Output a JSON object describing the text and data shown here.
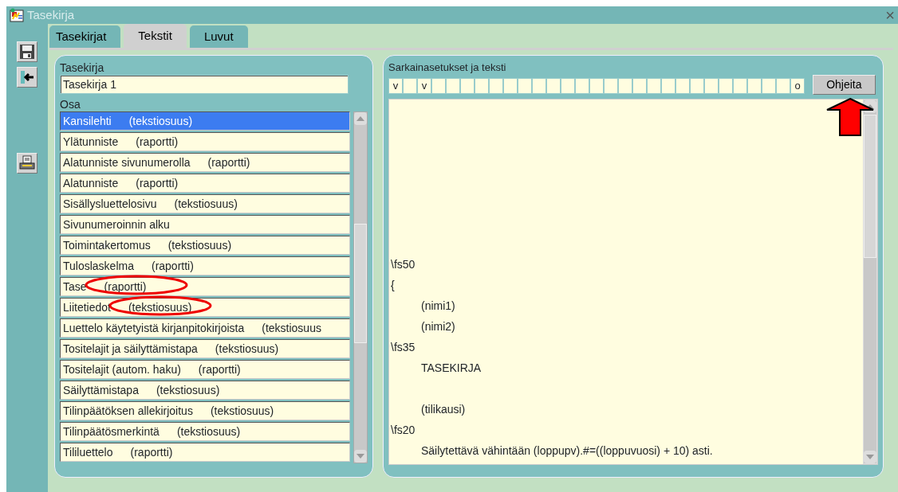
{
  "window": {
    "title": "Tasekirja",
    "close": "×"
  },
  "tabs": [
    {
      "label": "Tasekirjat",
      "selected": false
    },
    {
      "label": "Tekstit",
      "selected": true
    },
    {
      "label": "Luvut",
      "selected": false
    }
  ],
  "left_panel": {
    "book_label": "Tasekirja",
    "book_value": "Tasekirja 1",
    "part_label": "Osa",
    "parts": [
      {
        "name": "Kansilehti",
        "type": "(tekstiosuus)",
        "selected": true,
        "circled": false
      },
      {
        "name": "Ylätunniste",
        "type": "(raportti)",
        "selected": false,
        "circled": false
      },
      {
        "name": "Alatunniste sivunumerolla",
        "type": "(raportti)",
        "selected": false,
        "circled": false
      },
      {
        "name": "Alatunniste",
        "type": "(raportti)",
        "selected": false,
        "circled": false
      },
      {
        "name": "Sisällysluettelosivu",
        "type": "(tekstiosuus)",
        "selected": false,
        "circled": false
      },
      {
        "name": "Sivunumeroinnin alku",
        "selected": false,
        "circled": false
      },
      {
        "name": "Toimintakertomus",
        "type": "(tekstiosuus)",
        "selected": false,
        "circled": false
      },
      {
        "name": "Tuloslaskelma",
        "type": "(raportti)",
        "selected": false,
        "circled": false
      },
      {
        "name": "Tase",
        "type": "(raportti)",
        "selected": false,
        "circled": true
      },
      {
        "name": "Liitetiedot",
        "type": "(tekstiosuus)",
        "selected": false,
        "circled": true
      },
      {
        "name": "Luettelo käytetyistä kirjanpitokirjoista",
        "type": "(tekstiosuus",
        "selected": false,
        "circled": false
      },
      {
        "name": "Tositelajit ja säilyttämistapa",
        "type": "(tekstiosuus)",
        "selected": false,
        "circled": false
      },
      {
        "name": "Tositelajit (autom. haku)",
        "type": "(raportti)",
        "selected": false,
        "circled": false
      },
      {
        "name": "Säilyttämistapa",
        "type": "(tekstiosuus)",
        "selected": false,
        "circled": false
      },
      {
        "name": "Tilinpäätöksen allekirjoitus",
        "type": "(tekstiosuus)",
        "selected": false,
        "circled": false
      },
      {
        "name": "Tilinpäätösmerkintä",
        "type": "(tekstiosuus)",
        "selected": false,
        "circled": false
      },
      {
        "name": "Tililuettelo",
        "type": "(raportti)",
        "selected": false,
        "circled": false
      }
    ]
  },
  "right_panel": {
    "label": "Sarkainasetukset ja teksti",
    "tab_cells": [
      {
        "kind": "marked",
        "text": "v"
      },
      {
        "kind": "blank"
      },
      {
        "kind": "marked",
        "text": "v"
      },
      {
        "kind": "blank"
      },
      {
        "kind": "blank"
      },
      {
        "kind": "blank"
      },
      {
        "kind": "blank"
      },
      {
        "kind": "blank"
      },
      {
        "kind": "blank"
      },
      {
        "kind": "blank"
      },
      {
        "kind": "blank"
      },
      {
        "kind": "blank"
      },
      {
        "kind": "blank"
      },
      {
        "kind": "blank"
      },
      {
        "kind": "blank"
      },
      {
        "kind": "blank"
      },
      {
        "kind": "blank"
      },
      {
        "kind": "blank"
      },
      {
        "kind": "blank"
      },
      {
        "kind": "blank"
      },
      {
        "kind": "blank"
      },
      {
        "kind": "blank"
      },
      {
        "kind": "blank"
      },
      {
        "kind": "blank"
      },
      {
        "kind": "blank"
      },
      {
        "kind": "blank"
      },
      {
        "kind": "blank"
      },
      {
        "kind": "blank"
      },
      {
        "kind": "marked",
        "text": "o"
      }
    ],
    "help_button": {
      "label": "Ohjeita",
      "arrow_marked": true
    },
    "text_lines": [
      {
        "kind": "code",
        "text": "\\fs50"
      },
      {
        "kind": "code",
        "text": "{"
      },
      {
        "kind": "indented",
        "text": "(nimi1)"
      },
      {
        "kind": "indented",
        "text": "(nimi2)"
      },
      {
        "kind": "code",
        "text": "\\fs35"
      },
      {
        "kind": "indented",
        "text": "TASEKIRJA"
      },
      {
        "kind": "gap"
      },
      {
        "kind": "indented",
        "text": "(tilikausi)"
      },
      {
        "kind": "code",
        "text": "\\fs20"
      },
      {
        "kind": "indented",
        "text": "Säilytettävä vähintään (loppupv).#=((loppuvuosi) + 10) asti."
      }
    ]
  }
}
